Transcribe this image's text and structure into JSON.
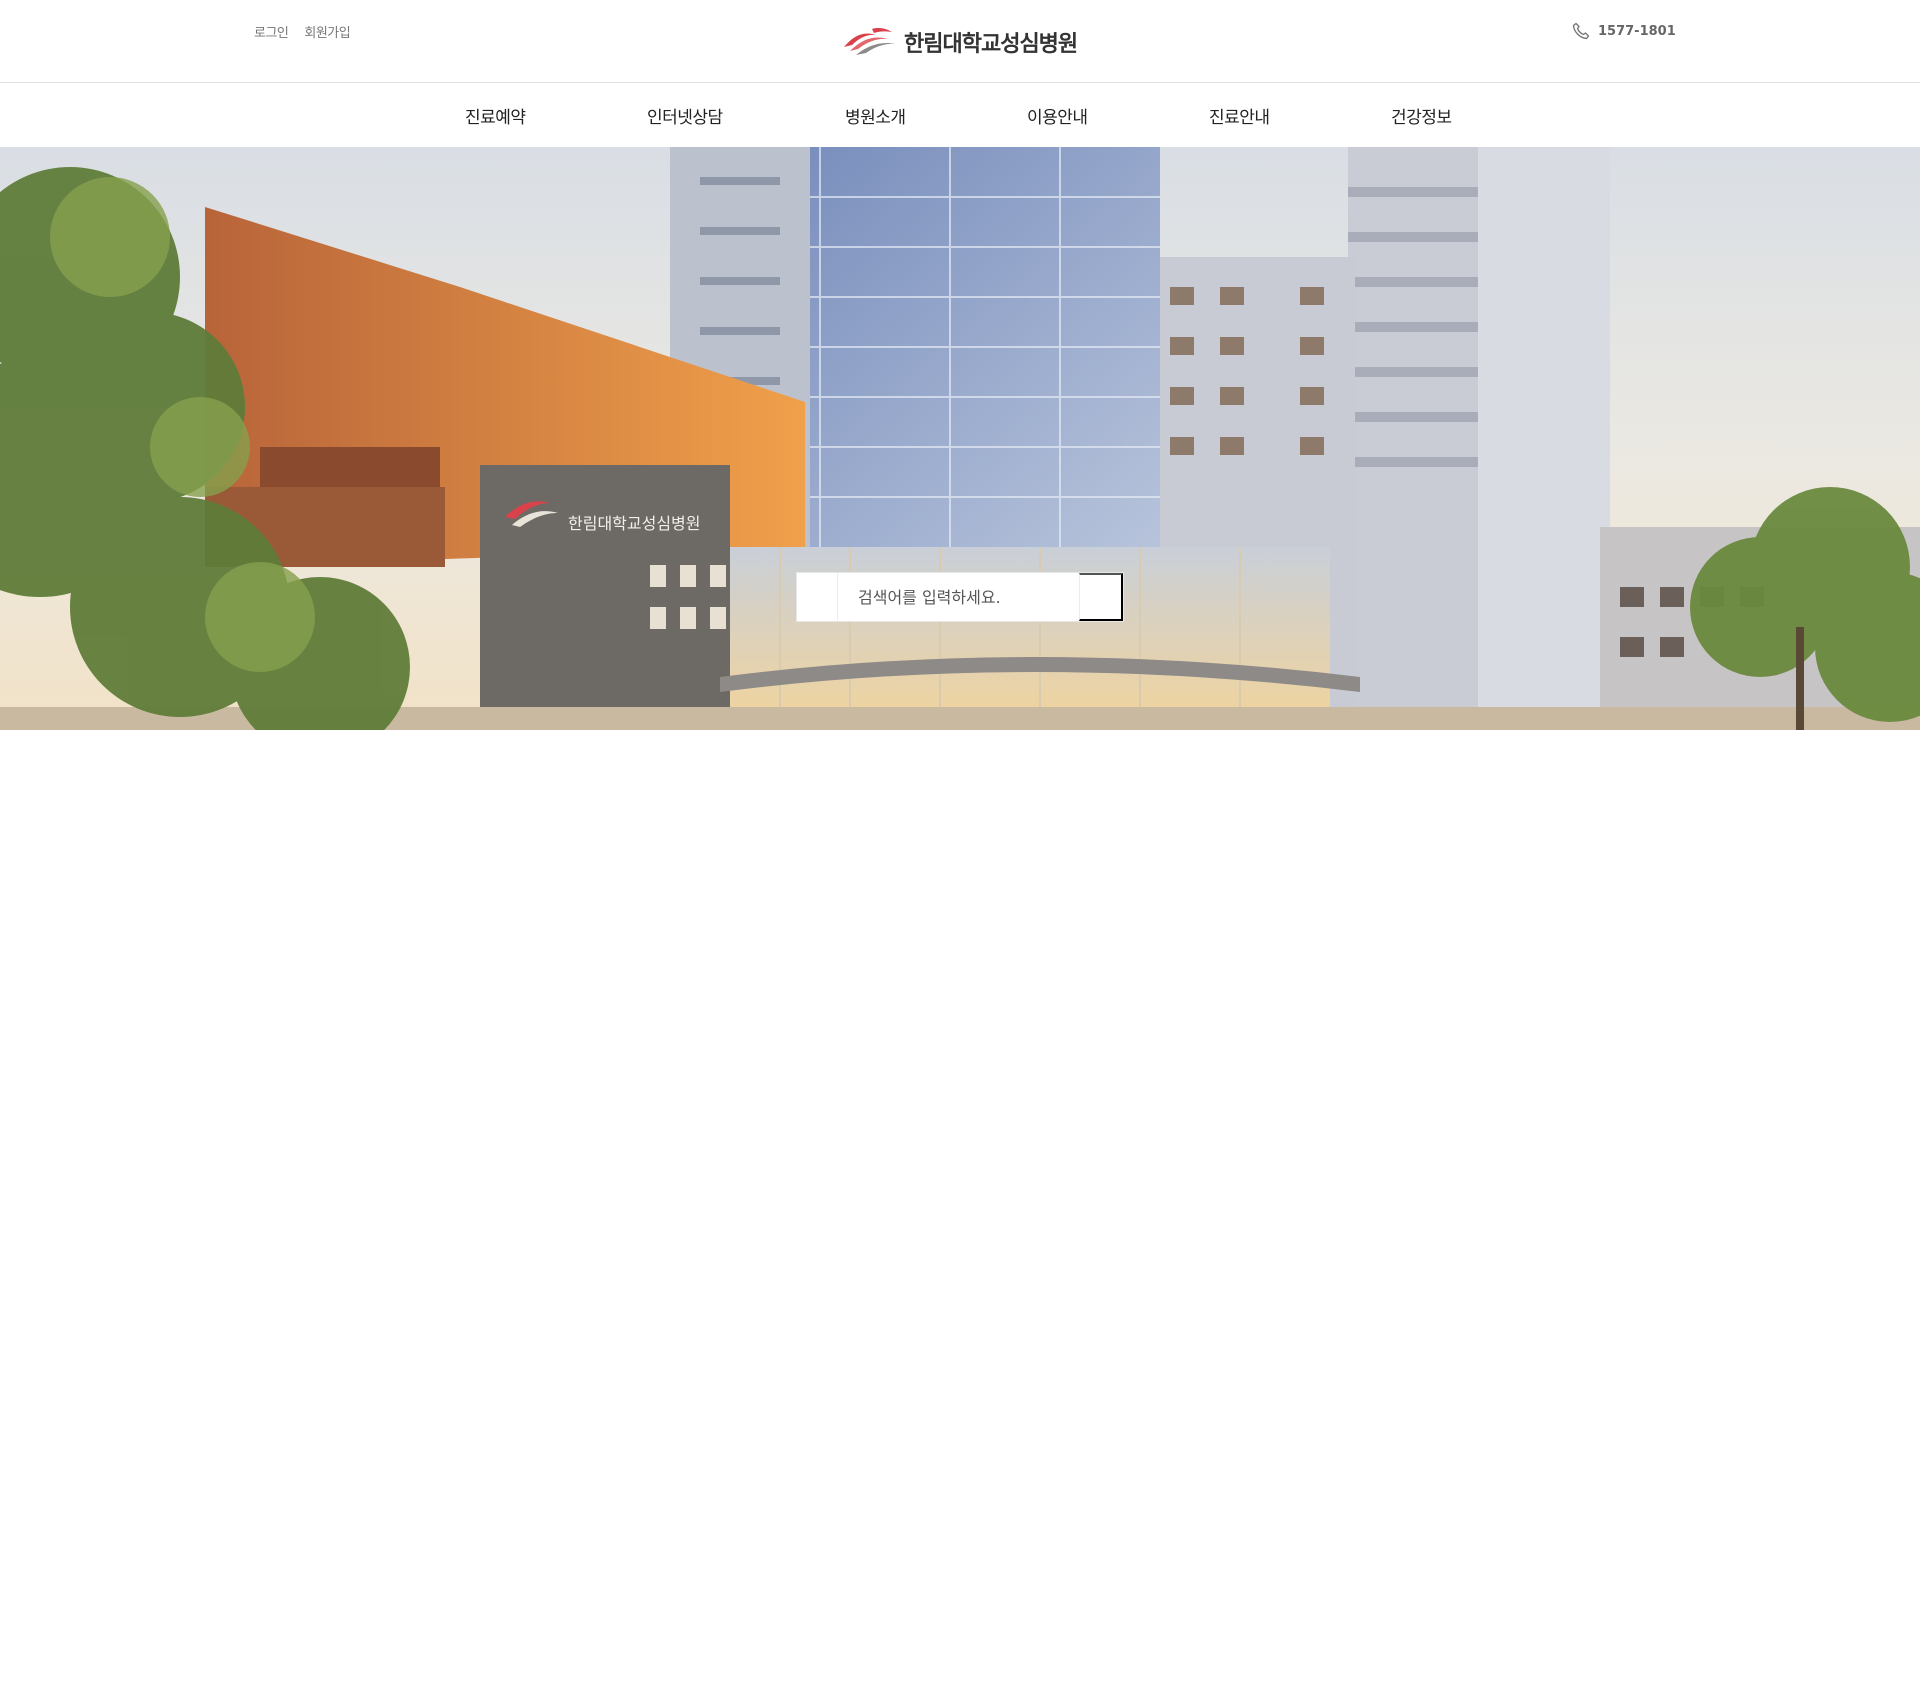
{
  "header": {
    "util_links": [
      "로그인",
      "회원가입"
    ],
    "logo_text": "한림대학교성심병원",
    "phone": "1577-1801",
    "logo_color": "#d9424a"
  },
  "nav": {
    "items": [
      "진료예약",
      "인터넷상담",
      "병원소개",
      "이용안내",
      "진료안내",
      "건강정보"
    ]
  },
  "hero": {
    "building_sign": "한림대학교성심병원",
    "search_placeholder": "검색어를 입력하세요."
  }
}
